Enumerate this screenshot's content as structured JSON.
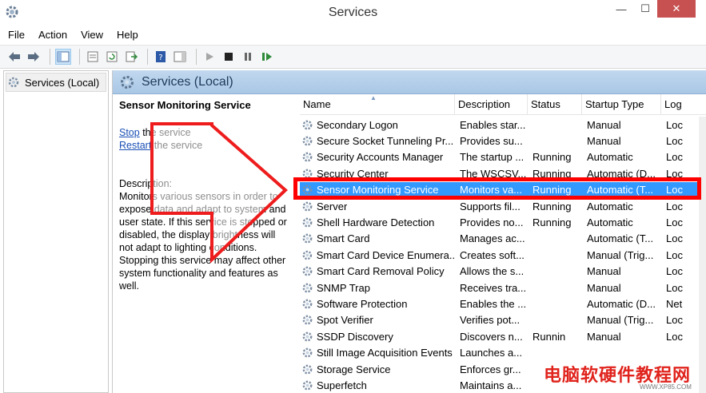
{
  "window": {
    "title": "Services",
    "minimize_label": "—",
    "maximize_label": "☐",
    "close_label": "✕"
  },
  "menu": [
    "File",
    "Action",
    "View",
    "Help"
  ],
  "tree": {
    "root_label": "Services (Local)"
  },
  "panel": {
    "header": "Services (Local)",
    "selected_service": "Sensor Monitoring Service",
    "stop_link": "Stop",
    "stop_suffix": " the service",
    "restart_link": "Restart",
    "restart_suffix": " the service",
    "description_label": "Description:",
    "description_text": "Monitors various sensors in order to expose data and adapt to system and user state.  If this service is stopped or disabled, the display brightness will not adapt to lighting conditions. Stopping this service may affect other system functionality and features as well."
  },
  "columns": {
    "name": "Name",
    "description": "Description",
    "status": "Status",
    "startup": "Startup Type",
    "log": "Log"
  },
  "services": [
    {
      "name": "Secondary Logon",
      "description": "Enables star...",
      "status": "",
      "startup": "Manual",
      "log": "Loc"
    },
    {
      "name": "Secure Socket Tunneling Pr...",
      "description": "Provides su...",
      "status": "",
      "startup": "Manual",
      "log": "Loc"
    },
    {
      "name": "Security Accounts Manager",
      "description": "The startup ...",
      "status": "Running",
      "startup": "Automatic",
      "log": "Loc"
    },
    {
      "name": "Security Center",
      "description": "The WSCSV...",
      "status": "Running",
      "startup": "Automatic (D...",
      "log": "Loc"
    },
    {
      "name": "Sensor Monitoring Service",
      "description": "Monitors va...",
      "status": "Running",
      "startup": "Automatic (T...",
      "log": "Loc",
      "selected": true
    },
    {
      "name": "Server",
      "description": "Supports fil...",
      "status": "Running",
      "startup": "Automatic",
      "log": "Loc"
    },
    {
      "name": "Shell Hardware Detection",
      "description": "Provides no...",
      "status": "Running",
      "startup": "Automatic",
      "log": "Loc"
    },
    {
      "name": "Smart Card",
      "description": "Manages ac...",
      "status": "",
      "startup": "Automatic (T...",
      "log": "Loc"
    },
    {
      "name": "Smart Card Device Enumera...",
      "description": "Creates soft...",
      "status": "",
      "startup": "Manual (Trig...",
      "log": "Loc"
    },
    {
      "name": "Smart Card Removal Policy",
      "description": "Allows the s...",
      "status": "",
      "startup": "Manual",
      "log": "Loc"
    },
    {
      "name": "SNMP Trap",
      "description": "Receives tra...",
      "status": "",
      "startup": "Manual",
      "log": "Loc"
    },
    {
      "name": "Software Protection",
      "description": "Enables the ...",
      "status": "",
      "startup": "Automatic (D...",
      "log": "Net"
    },
    {
      "name": "Spot Verifier",
      "description": "Verifies pot...",
      "status": "",
      "startup": "Manual (Trig...",
      "log": "Loc"
    },
    {
      "name": "SSDP Discovery",
      "description": "Discovers n...",
      "status": "Runnin",
      "startup": "Manual",
      "log": "Loc"
    },
    {
      "name": "Still Image Acquisition Events",
      "description": "Launches a...",
      "status": "",
      "startup": "",
      "log": ""
    },
    {
      "name": "Storage Service",
      "description": "Enforces gr...",
      "status": "",
      "startup": "",
      "log": ""
    },
    {
      "name": "Superfetch",
      "description": "Maintains a...",
      "status": "",
      "startup": "",
      "log": ""
    }
  ],
  "watermark": {
    "text": "电脑软硬件教程网",
    "url": "WWW.XP85.COM"
  },
  "colors": {
    "selection": "#3399ff",
    "highlight": "#ff0000",
    "header": "#b5cfea"
  }
}
